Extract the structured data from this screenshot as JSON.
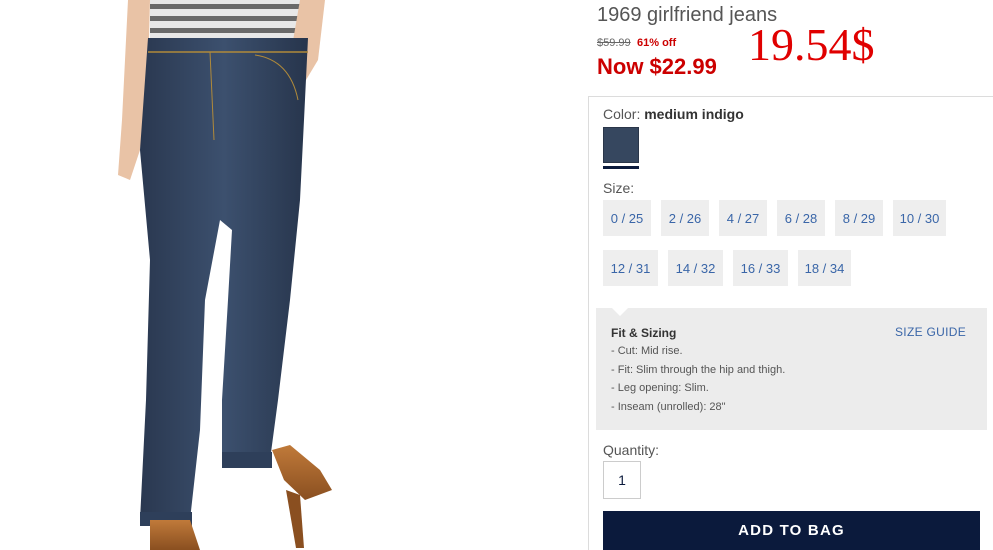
{
  "product": {
    "title": "1969 girlfriend jeans",
    "old_price": "$59.99",
    "discount": "61% off",
    "now_price": "Now $22.99",
    "annotation": "19.54$"
  },
  "color": {
    "label": "Color: ",
    "value": "medium indigo",
    "swatch_color": "#36475f"
  },
  "size": {
    "label": "Size:",
    "options": [
      "0 / 25",
      "2 / 26",
      "4 / 27",
      "6 / 28",
      "8 / 29",
      "10 / 30",
      "12 / 31",
      "14 / 32",
      "16 / 33",
      "18 / 34"
    ]
  },
  "fit": {
    "title": "Fit & Sizing",
    "size_guide": "SIZE GUIDE",
    "lines": [
      "- Cut: Mid rise.",
      "- Fit: Slim through the hip and thigh.",
      "- Leg opening: Slim.",
      "- Inseam (unrolled): 28\""
    ]
  },
  "quantity": {
    "label": "Quantity:",
    "value": "1"
  },
  "add_to_bag": "ADD TO BAG",
  "colors": {
    "price_red": "#cc0000",
    "navy": "#0b1a3c",
    "link_blue": "#3a66a8",
    "denim": "#36475f"
  }
}
